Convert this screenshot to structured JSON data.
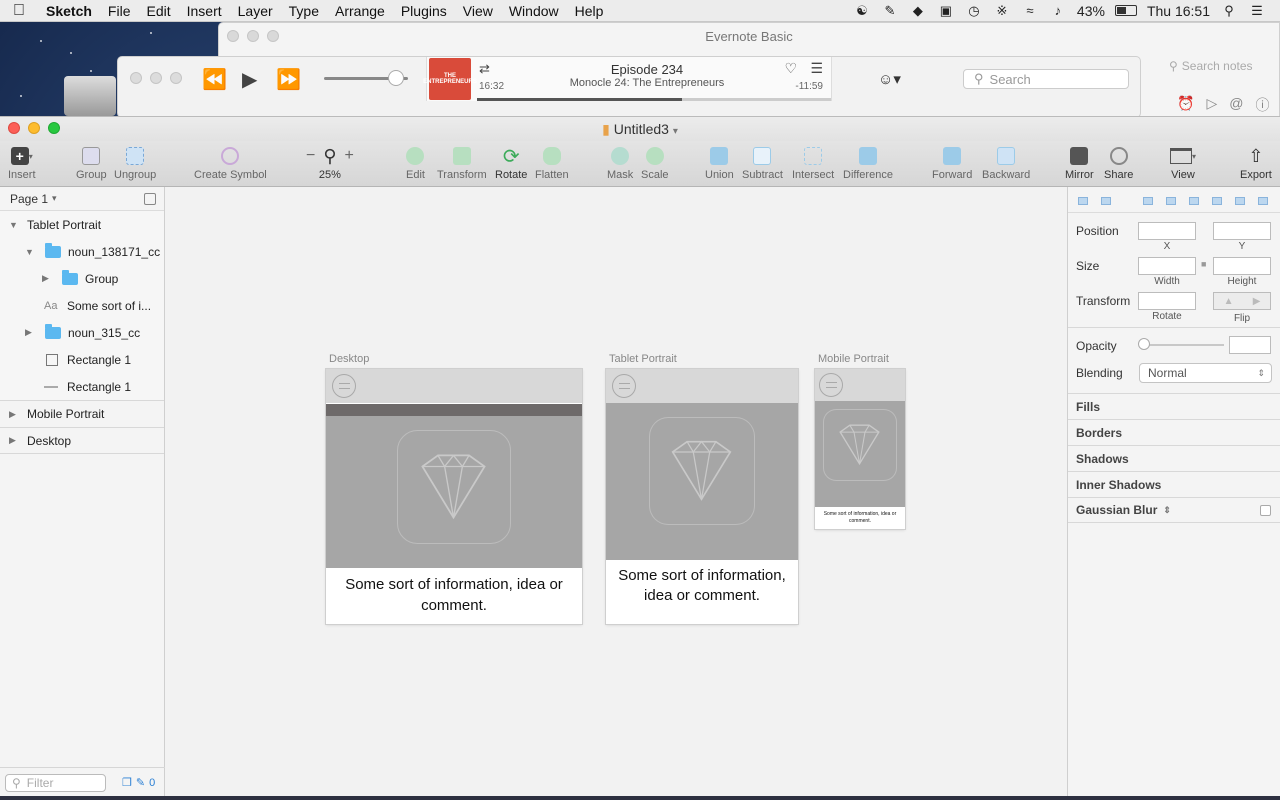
{
  "menubar": {
    "app": "Sketch",
    "items": [
      "File",
      "Edit",
      "Insert",
      "Layer",
      "Type",
      "Arrange",
      "Plugins",
      "View",
      "Window",
      "Help"
    ],
    "battery": "43%",
    "clock": "Thu 16:51"
  },
  "evernote": {
    "title": "Evernote Basic",
    "search_placeholder": "Search notes"
  },
  "itunes": {
    "episode": "Episode 234",
    "subtitle": "Monocle 24: The Entrepreneurs",
    "elapsed": "16:32",
    "remaining": "-11:59",
    "progress": 0.58,
    "volume": 0.86,
    "search_placeholder": "Search",
    "art_text": "THE ENTREPRENEURS"
  },
  "sketch": {
    "doc_title": "Untitled3",
    "toolbar": {
      "insert": "Insert",
      "group": "Group",
      "ungroup": "Ungroup",
      "create_symbol": "Create Symbol",
      "zoom": "25%",
      "edit": "Edit",
      "transform": "Transform",
      "rotate": "Rotate",
      "flatten": "Flatten",
      "mask": "Mask",
      "scale": "Scale",
      "union": "Union",
      "subtract": "Subtract",
      "intersect": "Intersect",
      "difference": "Difference",
      "forward": "Forward",
      "backward": "Backward",
      "mirror": "Mirror",
      "share": "Share",
      "view": "View",
      "export": "Export"
    },
    "page": "Page 1",
    "layers": [
      {
        "label": "Tablet Portrait"
      },
      {
        "label": "noun_138171_cc"
      },
      {
        "label": "Group"
      },
      {
        "label": "Some sort of i..."
      },
      {
        "label": "noun_315_cc"
      },
      {
        "label": "Rectangle 1"
      },
      {
        "label": "Rectangle 1"
      },
      {
        "label": "Mobile Portrait"
      },
      {
        "label": "Desktop"
      }
    ],
    "filter_placeholder": "Filter",
    "filter_count": "0",
    "artboards": [
      {
        "label": "Desktop",
        "text": "Some sort of information, idea or comment."
      },
      {
        "label": "Tablet Portrait",
        "text": "Some sort of information, idea or comment."
      },
      {
        "label": "Mobile Portrait",
        "text": "Some sort of information, idea or comment."
      }
    ],
    "inspector": {
      "position": "Position",
      "x": "X",
      "y": "Y",
      "size": "Size",
      "width": "Width",
      "height": "Height",
      "transform": "Transform",
      "rotate": "Rotate",
      "flip": "Flip",
      "opacity": "Opacity",
      "blending": "Blending",
      "blending_value": "Normal",
      "fills": "Fills",
      "borders": "Borders",
      "shadows": "Shadows",
      "inner_shadows": "Inner Shadows",
      "gaussian_blur": "Gaussian Blur"
    }
  },
  "colors": {
    "accent_blue": "#5bb8f0",
    "traffic_red": "#fc5f57",
    "traffic_yellow": "#fdbc2e",
    "traffic_green": "#28c840",
    "artboard_grey": "#a6a6a6"
  }
}
